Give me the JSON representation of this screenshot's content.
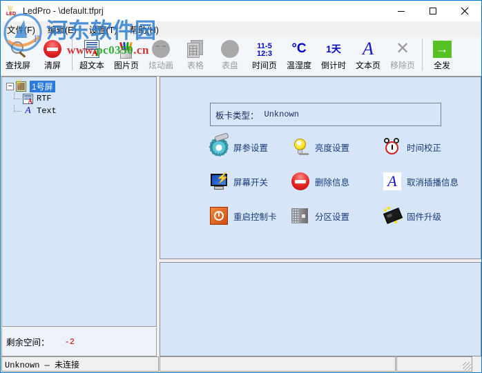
{
  "window": {
    "title": "LedPro - \\default.tfprj",
    "app_icon": "led-icon",
    "minimize_label": "—",
    "maximize_label": "□",
    "close_label": "✕"
  },
  "menubar": {
    "items": [
      {
        "label": "文件(F)",
        "name": "menu-file"
      },
      {
        "label": "编辑(E)",
        "name": "menu-edit"
      },
      {
        "label": "设置(T)",
        "name": "menu-settings"
      },
      {
        "label": "帮助(H)",
        "name": "menu-help"
      }
    ]
  },
  "toolbar": {
    "buttons": [
      {
        "label": "查找屏",
        "icon": "magnifier-icon",
        "disabled": false
      },
      {
        "label": "清屏",
        "icon": "stop-sign-icon",
        "disabled": false
      },
      {
        "label": "超文本",
        "icon": "rich-text-document-icon",
        "disabled": false
      },
      {
        "label": "图片页",
        "icon": "pen-cup-icon",
        "disabled": false
      },
      {
        "label": "炫动画",
        "icon": "animation-icon",
        "disabled": true
      },
      {
        "label": "表格",
        "icon": "table-icon",
        "disabled": true
      },
      {
        "label": "表盘",
        "icon": "dial-icon",
        "disabled": true
      },
      {
        "label": "时间页",
        "icon": "clock-text-icon",
        "disabled": false,
        "icon_text_1": "11-5",
        "icon_text_2": "12:3"
      },
      {
        "label": "温湿度",
        "icon": "celsius-icon",
        "disabled": false,
        "icon_text": "°C"
      },
      {
        "label": "倒计时",
        "icon": "countdown-icon",
        "disabled": false,
        "icon_text": "1天"
      },
      {
        "label": "文本页",
        "icon": "letter-a-icon",
        "disabled": false,
        "icon_text": "A"
      },
      {
        "label": "移除页",
        "icon": "remove-page-icon",
        "disabled": true,
        "icon_text": "✕"
      },
      {
        "label": "全发",
        "icon": "send-all-arrow-icon",
        "disabled": false,
        "icon_text": "→"
      }
    ],
    "separator_after": [
      1,
      11
    ]
  },
  "tree": {
    "root": {
      "label": "1号屏",
      "icon": "screen-icon",
      "expander": "−",
      "selected": true
    },
    "children": [
      {
        "label": "RTF",
        "icon": "rtf-document-icon"
      },
      {
        "label": "Text",
        "icon": "text-a-icon"
      }
    ]
  },
  "space_panel": {
    "label": "剩余空间：",
    "value": "-2"
  },
  "main_panel": {
    "card_type": {
      "label": "板卡类型：",
      "value": "Unknown"
    },
    "actions": [
      {
        "label": "屏参设置",
        "icon": "gear-wrench-icon",
        "name": "screen-params-button"
      },
      {
        "label": "亮度设置",
        "icon": "lightbulb-icon",
        "name": "brightness-button"
      },
      {
        "label": "时间校正",
        "icon": "alarm-clock-icon",
        "name": "time-correction-button"
      },
      {
        "label": "屏幕开关",
        "icon": "monitor-power-icon",
        "name": "screen-switch-button"
      },
      {
        "label": "删除信息",
        "icon": "no-entry-icon",
        "name": "delete-info-button"
      },
      {
        "label": "取消插播信息",
        "icon": "letter-a-icon",
        "name": "cancel-insert-button"
      },
      {
        "label": "重启控制卡",
        "icon": "power-restart-icon",
        "name": "restart-card-button"
      },
      {
        "label": "分区设置",
        "icon": "partition-icon",
        "name": "partition-button"
      },
      {
        "label": "固件升级",
        "icon": "chip-icon",
        "name": "firmware-upgrade-button"
      }
    ]
  },
  "statusbar": {
    "left": "Unknown — 未连接",
    "middle": "",
    "right": ""
  },
  "watermark": {
    "text_blue": "河东软件园",
    "text_green_prefix": "www.",
    "text_green_mid": "pc0350",
    "text_green_suffix": ".cn",
    "logo_name": "hedong-logo"
  },
  "colors": {
    "accent": "#0078d7",
    "panel_bg": "#d6e5f8",
    "toolbar_bg": "#f3f7fb",
    "send_green": "#55c122",
    "warn_red": "#c00000",
    "label_blue": "#1a3a7a"
  }
}
